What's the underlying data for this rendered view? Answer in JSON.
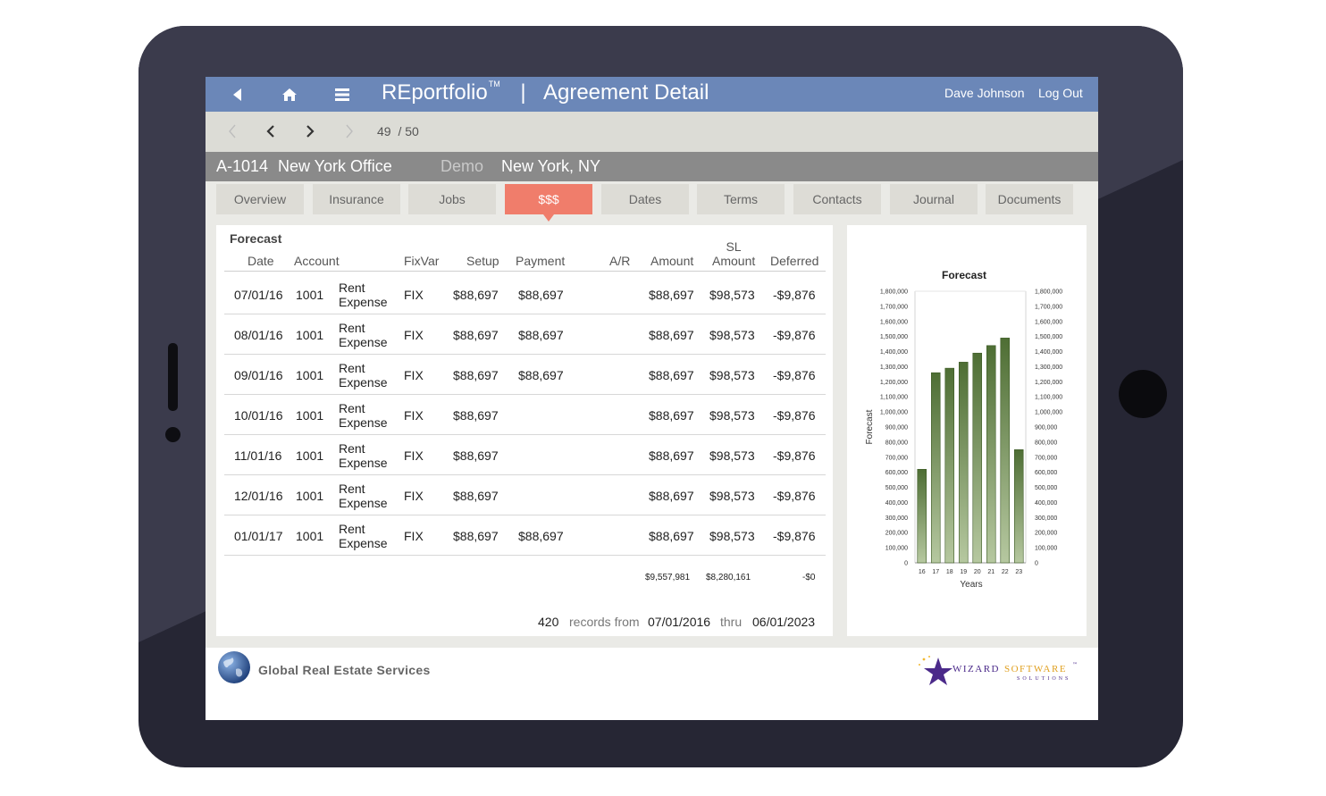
{
  "app": {
    "brand": "REportfolio",
    "trademark": "TM",
    "separator": "|",
    "page_title": "Agreement Detail",
    "user_name": "Dave Johnson",
    "logout_label": "Log Out"
  },
  "pager": {
    "current": "49",
    "total": "/ 50"
  },
  "record": {
    "id": "A-1014",
    "name": "New York Office",
    "tag": "Demo",
    "location": "New York, NY"
  },
  "tabs": [
    {
      "label": "Overview",
      "active": false
    },
    {
      "label": "Insurance",
      "active": false
    },
    {
      "label": "Jobs",
      "active": false
    },
    {
      "label": "$$$",
      "active": true
    },
    {
      "label": "Dates",
      "active": false
    },
    {
      "label": "Terms",
      "active": false
    },
    {
      "label": "Contacts",
      "active": false
    },
    {
      "label": "Journal",
      "active": false
    },
    {
      "label": "Documents",
      "active": false
    }
  ],
  "forecast": {
    "title": "Forecast",
    "columns": {
      "date": "Date",
      "account": "Account",
      "fixvar": "FixVar",
      "setup": "Setup",
      "payment": "Payment",
      "ar": "A/R",
      "amount": "Amount",
      "sl_line1": "SL",
      "sl_line2": "Amount",
      "deferred": "Deferred"
    },
    "rows": [
      {
        "date": "07/01/16",
        "account": "1001",
        "desc1": "Rent",
        "desc2": "Expense",
        "fixvar": "FIX",
        "setup": "$88,697",
        "payment": "$88,697",
        "ar": "",
        "amount": "$88,697",
        "sl_amount": "$98,573",
        "deferred": "-$9,876"
      },
      {
        "date": "08/01/16",
        "account": "1001",
        "desc1": "Rent",
        "desc2": "Expense",
        "fixvar": "FIX",
        "setup": "$88,697",
        "payment": "$88,697",
        "ar": "",
        "amount": "$88,697",
        "sl_amount": "$98,573",
        "deferred": "-$9,876"
      },
      {
        "date": "09/01/16",
        "account": "1001",
        "desc1": "Rent",
        "desc2": "Expense",
        "fixvar": "FIX",
        "setup": "$88,697",
        "payment": "$88,697",
        "ar": "",
        "amount": "$88,697",
        "sl_amount": "$98,573",
        "deferred": "-$9,876"
      },
      {
        "date": "10/01/16",
        "account": "1001",
        "desc1": "Rent",
        "desc2": "Expense",
        "fixvar": "FIX",
        "setup": "$88,697",
        "payment": "",
        "ar": "",
        "amount": "$88,697",
        "sl_amount": "$98,573",
        "deferred": "-$9,876"
      },
      {
        "date": "11/01/16",
        "account": "1001",
        "desc1": "Rent",
        "desc2": "Expense",
        "fixvar": "FIX",
        "setup": "$88,697",
        "payment": "",
        "ar": "",
        "amount": "$88,697",
        "sl_amount": "$98,573",
        "deferred": "-$9,876"
      },
      {
        "date": "12/01/16",
        "account": "1001",
        "desc1": "Rent",
        "desc2": "Expense",
        "fixvar": "FIX",
        "setup": "$88,697",
        "payment": "",
        "ar": "",
        "amount": "$88,697",
        "sl_amount": "$98,573",
        "deferred": "-$9,876"
      },
      {
        "date": "01/01/17",
        "account": "1001",
        "desc1": "Rent",
        "desc2": "Expense",
        "fixvar": "FIX",
        "setup": "$88,697",
        "payment": "$88,697",
        "ar": "",
        "amount": "$88,697",
        "sl_amount": "$98,573",
        "deferred": "-$9,876"
      }
    ],
    "totals": {
      "amount": "$9,557,981",
      "sl_amount": "$8,280,161",
      "deferred": "-$0"
    },
    "summary": {
      "count": "420",
      "records_from": "records from",
      "from": "07/01/2016",
      "thru": "thru",
      "to": "06/01/2023"
    }
  },
  "chart_data": {
    "type": "bar",
    "title": "Forecast",
    "xlabel": "Years",
    "ylabel": "Forecast",
    "categories": [
      "16",
      "17",
      "18",
      "19",
      "20",
      "21",
      "22",
      "23"
    ],
    "values": [
      620000,
      1260000,
      1290000,
      1330000,
      1390000,
      1440000,
      1490000,
      750000
    ],
    "ylim": [
      0,
      1800000
    ],
    "yticks": [
      "0",
      "100,000",
      "200,000",
      "300,000",
      "400,000",
      "500,000",
      "600,000",
      "700,000",
      "800,000",
      "900,000",
      "1,000,000",
      "1,100,000",
      "1,200,000",
      "1,300,000",
      "1,400,000",
      "1,500,000",
      "1,600,000",
      "1,700,000",
      "1,800,000"
    ],
    "secondary_axis": true,
    "bar_color": "#4e6e34",
    "bar_color_light": "#b6c8a0",
    "grid": false
  },
  "footer": {
    "company": "Global Real Estate Services",
    "vendor_word1": "WIZARD",
    "vendor_word2": "SOFTWARE",
    "vendor_tm": "™",
    "vendor_sub": "SOLUTIONS"
  },
  "colors": {
    "topbar": "#6b87b8",
    "active_tab": "#f07d6b",
    "titlebar": "#8a8a8a",
    "tablet": "#262634"
  },
  "icons": {
    "back": "back-arrow-icon",
    "home": "home-icon",
    "menu": "menu-icon",
    "first": "first-record-icon",
    "prev": "previous-record-icon",
    "next": "next-record-icon",
    "last": "last-record-icon",
    "globe": "globe-icon",
    "star": "star-logo-icon"
  }
}
